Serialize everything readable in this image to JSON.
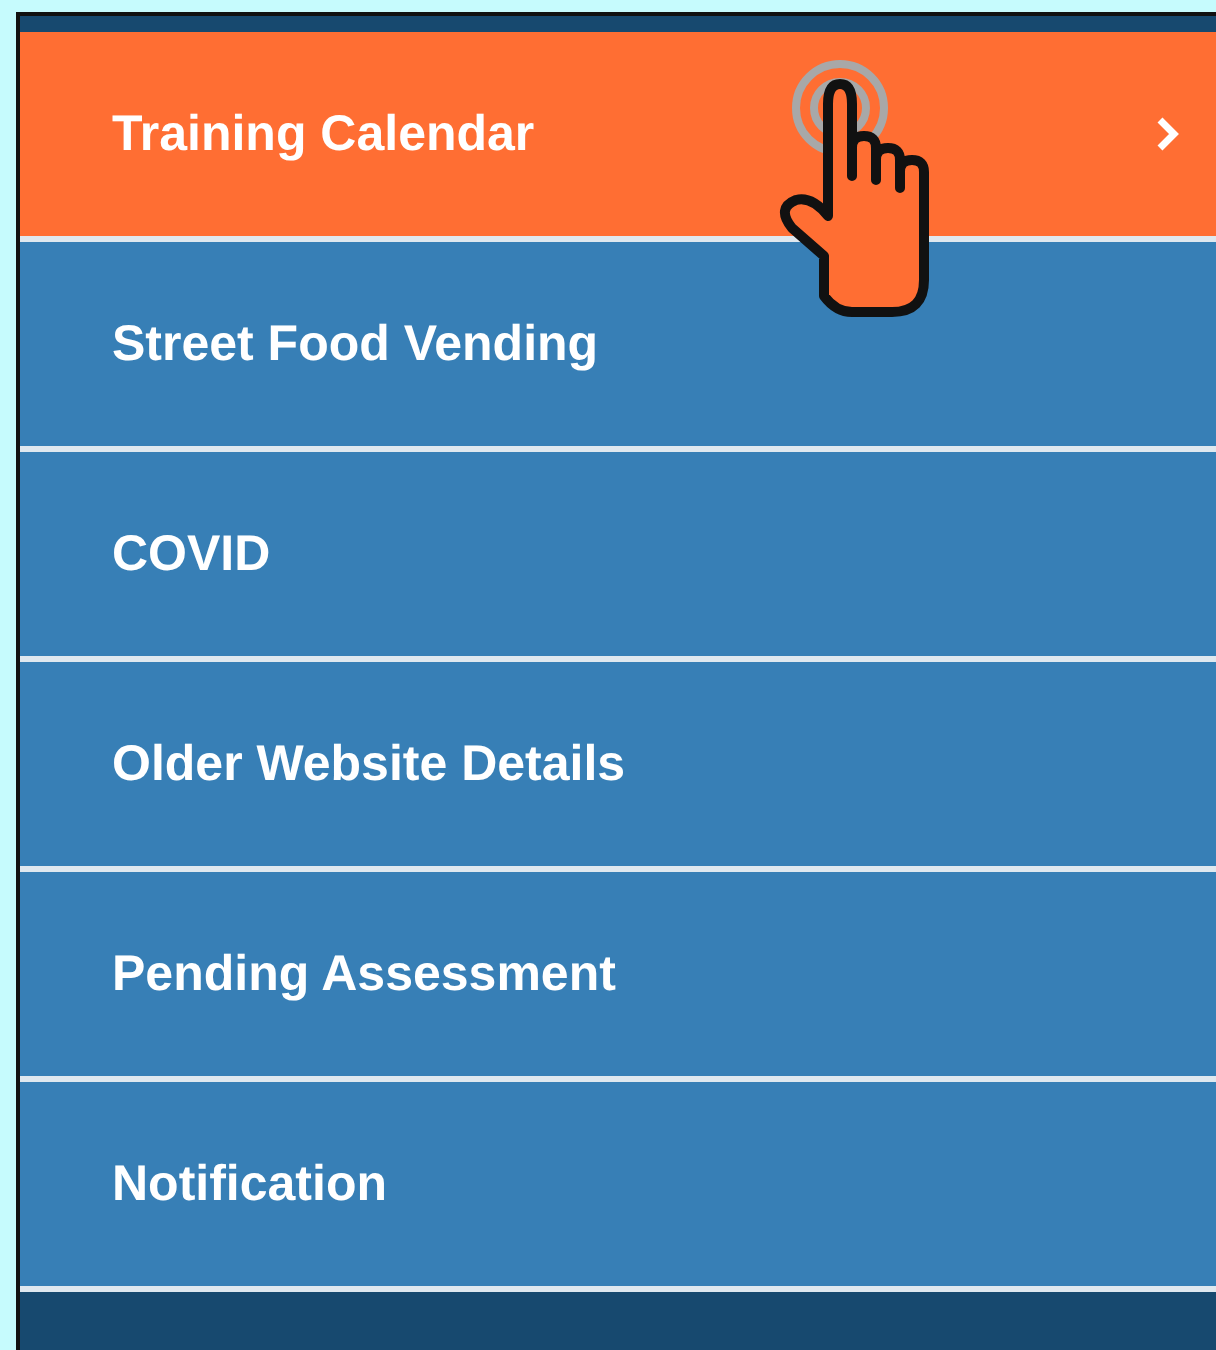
{
  "menu": {
    "items": [
      {
        "label": "Training Calendar",
        "selected": true
      },
      {
        "label": "Street Food Vending",
        "selected": false
      },
      {
        "label": "COVID",
        "selected": false
      },
      {
        "label": "Older Website Details",
        "selected": false
      },
      {
        "label": "Pending Assessment",
        "selected": false
      },
      {
        "label": "Notification",
        "selected": false
      }
    ]
  }
}
